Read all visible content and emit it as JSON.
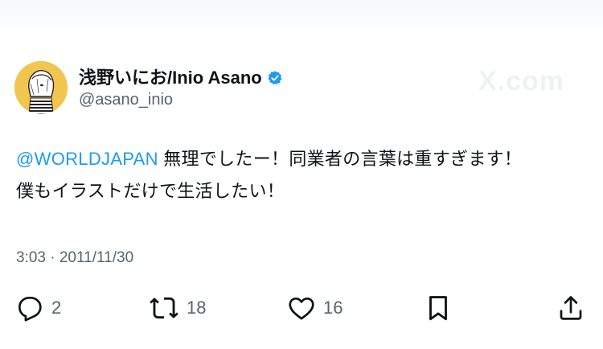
{
  "watermark": "X.com",
  "author": {
    "display_name": "浅野いにお/Inio Asano",
    "handle": "@asano_inio",
    "verified_icon": "verified-badge-icon",
    "avatar_color": "#f1c64e"
  },
  "tweet": {
    "mention": "@WORLDJAPAN",
    "text_line1": " 無理でしたー！同業者の言葉は重すぎます！",
    "text_line2": "僕もイラストだけで生活したい！",
    "timestamp": "3:03 · 2011/11/30"
  },
  "actions": {
    "reply": {
      "icon": "reply-icon",
      "count": "2"
    },
    "retweet": {
      "icon": "retweet-icon",
      "count": "18"
    },
    "like": {
      "icon": "heart-icon",
      "count": "16"
    },
    "bookmark": {
      "icon": "bookmark-icon"
    },
    "share": {
      "icon": "share-icon"
    }
  },
  "colors": {
    "link": "#1d9bf0",
    "secondary_text": "#536471",
    "primary_text": "#0f1419"
  }
}
